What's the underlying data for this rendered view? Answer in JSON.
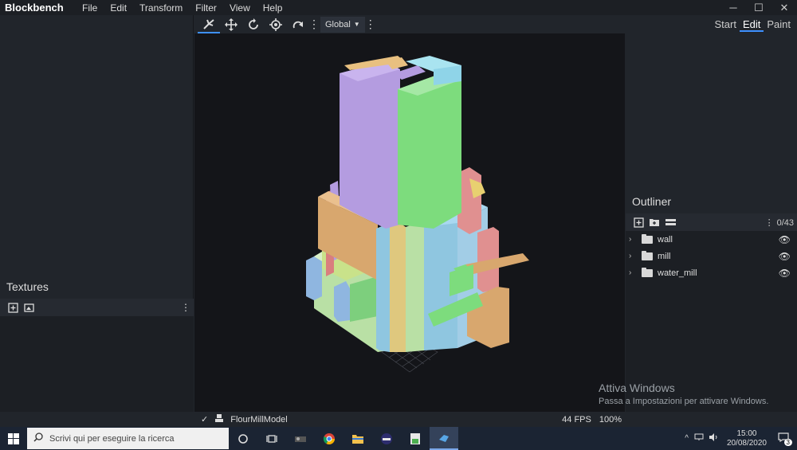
{
  "app": {
    "title": "Blockbench"
  },
  "menu": [
    "File",
    "Edit",
    "Transform",
    "Filter",
    "View",
    "Help"
  ],
  "window_controls": {
    "minimize": "─",
    "maximize": "☐",
    "close": "✕"
  },
  "viewport_toolbar": {
    "space_select": "Global"
  },
  "modes": [
    "Start",
    "Edit",
    "Paint"
  ],
  "active_mode": "Edit",
  "textures": {
    "title": "Textures"
  },
  "outliner": {
    "title": "Outliner",
    "count": "0/43",
    "items": [
      {
        "label": "wall"
      },
      {
        "label": "mill"
      },
      {
        "label": "water_mill"
      }
    ]
  },
  "status": {
    "model_name": "FlourMillModel",
    "fps": "44 FPS",
    "zoom": "100%"
  },
  "watermark": {
    "line1": "Attiva Windows",
    "line2": "Passa a Impostazioni per attivare Windows."
  },
  "taskbar": {
    "search_placeholder": "Scrivi qui per eseguire la ricerca",
    "time": "15:00",
    "date": "20/08/2020",
    "notifications": "3"
  },
  "colors": {
    "accent": "#3e90ff",
    "viewport_bg": "#141519",
    "panel_bg": "#21252b"
  }
}
